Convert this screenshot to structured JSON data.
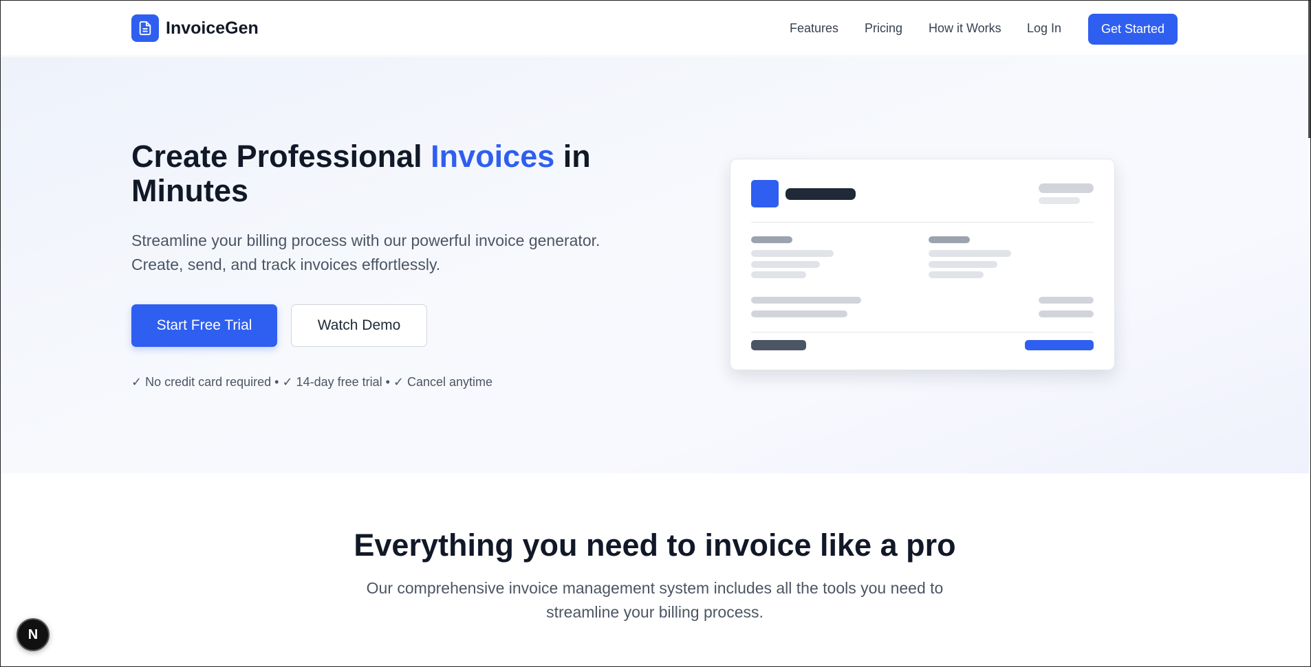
{
  "header": {
    "logo_text": "InvoiceGen",
    "logo_icon": "document-icon",
    "nav": [
      "Features",
      "Pricing",
      "How it Works",
      "Log In"
    ],
    "cta": "Get Started"
  },
  "hero": {
    "title_part1": "Create Professional ",
    "title_accent": "Invoices",
    "title_part2": " in Minutes",
    "subtitle": "Streamline your billing process with our powerful invoice generator. Create, send, and track invoices effortlessly.",
    "primary_button": "Start Free Trial",
    "secondary_button": "Watch Demo",
    "perks": "✓ No credit card required • ✓ 14-day free trial • ✓ Cancel anytime"
  },
  "features": {
    "title": "Everything you need to invoice like a pro",
    "subtitle": "Our comprehensive invoice management system includes all the tools you need to streamline your billing process."
  },
  "dev_badge": "N",
  "colors": {
    "accent": "#2f5ff0",
    "text_dark": "#111827",
    "text_muted": "#4b5563"
  }
}
